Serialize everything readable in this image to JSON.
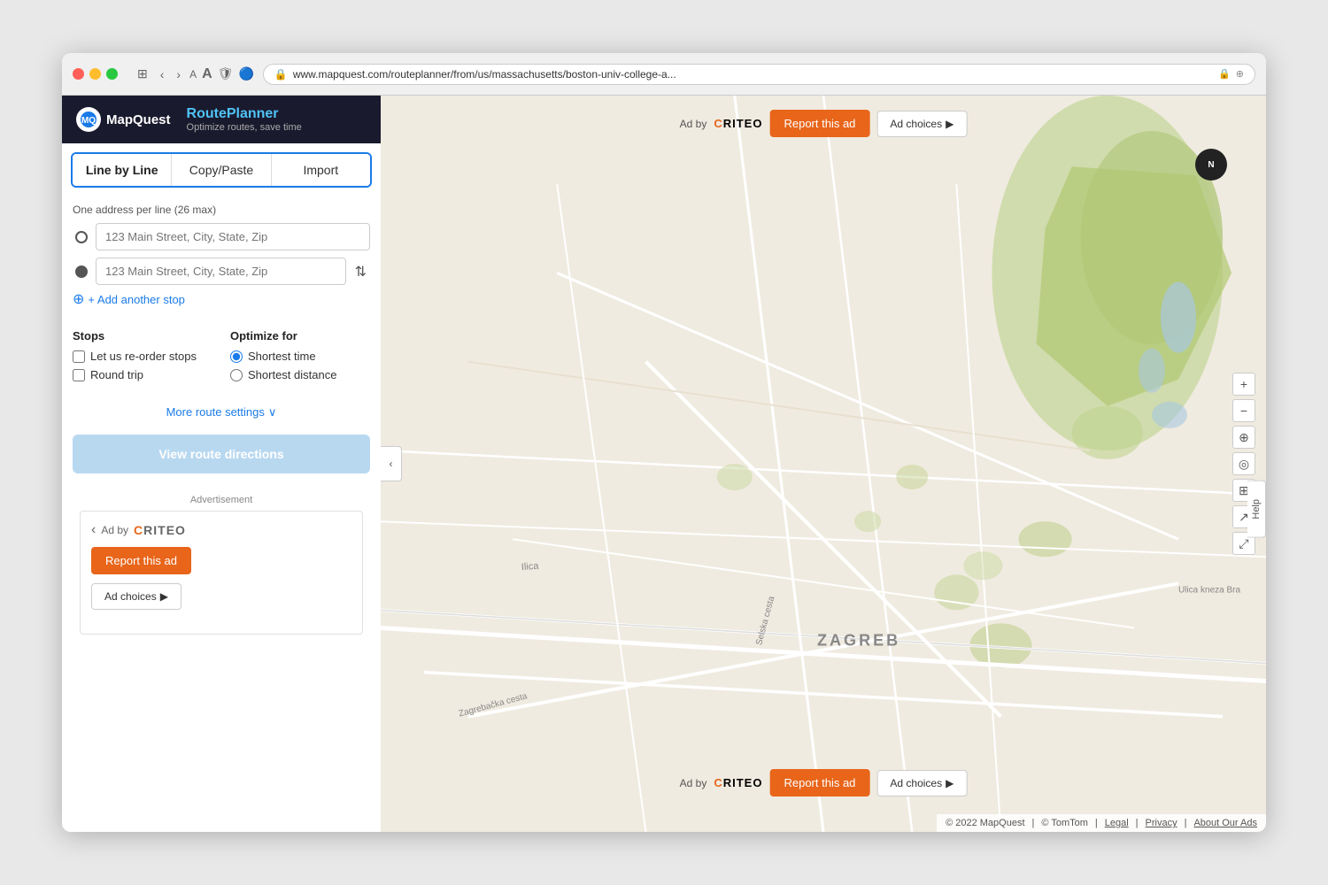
{
  "browser": {
    "url": "www.mapquest.com/routeplanner/from/us/massachusetts/boston-univ-college-a...",
    "back_label": "‹",
    "forward_label": "›",
    "font_smaller": "A",
    "font_larger": "A"
  },
  "sidebar": {
    "logo_text": "MapQuest",
    "route_planner_title": "Route",
    "route_planner_title_colored": "Planner",
    "route_planner_subtitle": "Optimize routes, save time",
    "tabs": [
      {
        "label": "Line by Line",
        "active": true
      },
      {
        "label": "Copy/Paste",
        "active": false
      },
      {
        "label": "Import",
        "active": false
      }
    ],
    "address_hint": "One address per line",
    "address_max": "(26 max)",
    "input1_placeholder": "123 Main Street, City, State, Zip",
    "input2_placeholder": "123 Main Street, City, State, Zip",
    "add_stop_label": "+ Add another stop",
    "stops_section": {
      "title": "Stops",
      "reorder_label": "Let us re-order stops",
      "round_trip_label": "Round trip"
    },
    "optimize_section": {
      "title": "Optimize for",
      "shortest_time_label": "Shortest time",
      "shortest_distance_label": "Shortest distance"
    },
    "more_settings_label": "More route settings",
    "view_directions_label": "View route directions",
    "ad_label": "Advertisement",
    "ad_by_label": "Ad by",
    "criteo_label": "CRITEO",
    "report_ad_label": "Report this ad",
    "ad_choices_label": "Ad choices"
  },
  "map": {
    "ad_top": {
      "ad_by": "Ad by",
      "criteo": "CRITEO",
      "report_label": "Report this ad",
      "choices_label": "Ad choices"
    },
    "ad_bottom": {
      "ad_by": "Ad by",
      "criteo": "CRITEO",
      "report_label": "Report this ad",
      "choices_label": "Ad choices"
    },
    "city_label": "ZAGREB",
    "street1": "Ilica",
    "street2": "Selska cesta",
    "street3": "Ulica kneza Bra",
    "street4": "Zagrebačka cesta",
    "compass_label": "N",
    "footer": {
      "copyright": "© 2022 MapQuest",
      "tomtom": "© TomTom",
      "legal": "Legal",
      "privacy": "Privacy",
      "about": "About Our Ads"
    },
    "help_label": "Help",
    "collapse_icon": "‹",
    "zoom_in": "+",
    "zoom_out": "−"
  }
}
